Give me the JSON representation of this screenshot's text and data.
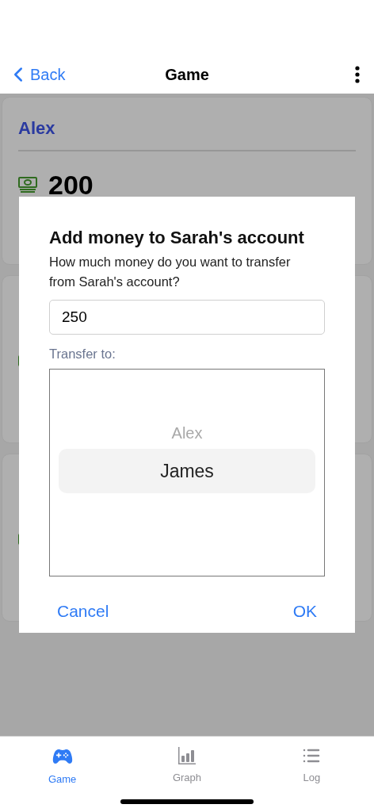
{
  "nav": {
    "back": "Back",
    "title": "Game"
  },
  "players": [
    {
      "kind": "visible",
      "name": "Alex",
      "balance": "200"
    },
    {
      "kind": "covered"
    },
    {
      "kind": "covered"
    }
  ],
  "dialog": {
    "title": "Add money to Sarah's account",
    "message": "How much money do you want to transfer from Sarah's account?",
    "amount": "250",
    "picker_label": "Transfer to:",
    "options": [
      {
        "label": "Alex",
        "selected": false
      },
      {
        "label": "James",
        "selected": true
      }
    ],
    "cancel": "Cancel",
    "ok": "OK"
  },
  "tabs": [
    {
      "kind": "game",
      "label": "Game",
      "selected": true
    },
    {
      "kind": "graph",
      "label": "Graph",
      "selected": false
    },
    {
      "kind": "log",
      "label": "Log",
      "selected": false
    }
  ]
}
